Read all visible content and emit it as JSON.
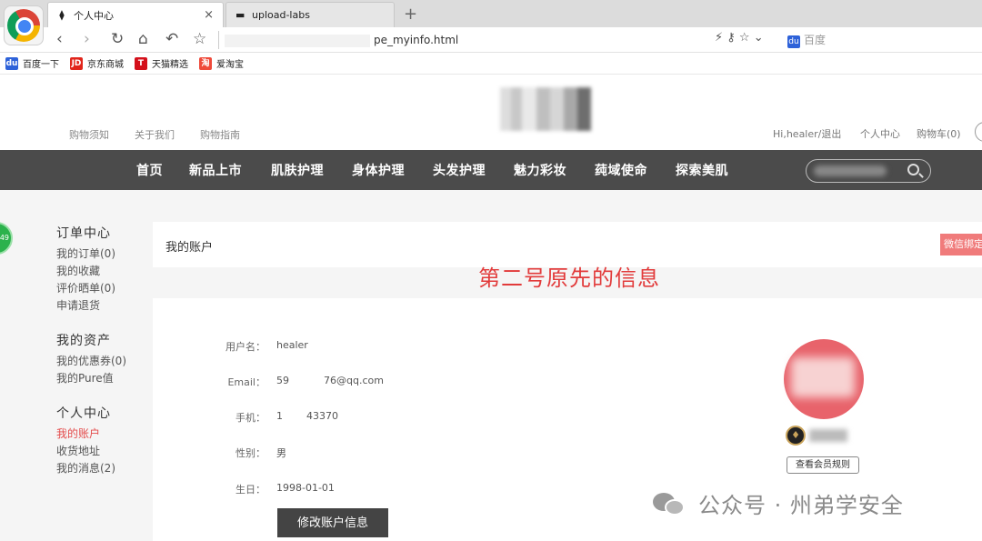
{
  "browser": {
    "tabs": [
      {
        "label": "个人中心",
        "icon": "page-favicon"
      },
      {
        "label": "upload-labs",
        "icon": "folder-favicon"
      }
    ],
    "url_suffix": "pe_myinfo.html",
    "search_engine": "百度",
    "bookmarks": [
      {
        "label": "百度一下",
        "icon_color": "#2e62d9",
        "icon_text": "du"
      },
      {
        "label": "京东商城",
        "icon_color": "#e1251b",
        "icon_text": "JD"
      },
      {
        "label": "天猫精选",
        "icon_color": "#d4101b",
        "icon_text": "T"
      },
      {
        "label": "爱淘宝",
        "icon_color": "#ef4a3a",
        "icon_text": "淘"
      }
    ]
  },
  "site": {
    "top_links": [
      "购物须知",
      "关于我们",
      "购物指南"
    ],
    "greeting": "Hi,healer/退出",
    "user_center": "个人中心",
    "cart": "购物车(0)",
    "nav": [
      "首页",
      "新品上市",
      "肌肤护理",
      "身体护理",
      "头发护理",
      "魅力彩妆",
      "莼域使命",
      "探索美肌"
    ],
    "green_badge": "49"
  },
  "sidebar": {
    "groups": [
      {
        "title": "订单中心",
        "links": [
          "我的订单(0)",
          "我的收藏",
          "评价晒单(0)",
          "申请退货"
        ]
      },
      {
        "title": "我的资产",
        "links": [
          "我的优惠券(0)",
          "我的Pure值"
        ]
      },
      {
        "title": "个人中心",
        "links": [
          "我的账户",
          "收货地址",
          "我的消息(2)"
        ]
      }
    ],
    "active_link": "我的账户"
  },
  "account": {
    "panel_title": "我的账户",
    "wechat_button": "微信绑定",
    "overlay_note": "第二号原先的信息",
    "fields": [
      {
        "label": "用户名：",
        "value": "healer"
      },
      {
        "label": "Email：",
        "value_prefix": "59",
        "value_suffix": "76@qq.com"
      },
      {
        "label": "手机：",
        "value_prefix": "1",
        "value_suffix": "43370"
      },
      {
        "label": "性别：",
        "value": "男"
      },
      {
        "label": "生日：",
        "value": "1998-01-01"
      }
    ],
    "edit_button": "修改账户信息",
    "rules_button": "查看会员规则"
  },
  "watermark": "公众号 · 州弟学安全",
  "colors": {
    "nav_bg": "#4b4b4b",
    "accent_red": "#e23b3b",
    "avatar": "#e8636b"
  }
}
